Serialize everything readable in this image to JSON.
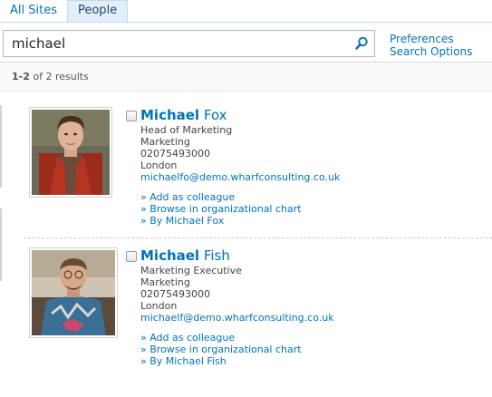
{
  "tabs": [
    {
      "label": "All Sites",
      "active": false
    },
    {
      "label": "People",
      "active": true
    }
  ],
  "search": {
    "query": "michael",
    "button_icon": "search-icon"
  },
  "links": {
    "preferences": "Preferences",
    "search_options": "Search Options"
  },
  "results_summary": {
    "range": "1-2",
    "text": "of 2 results"
  },
  "results": [
    {
      "name_highlight": "Michael",
      "name_rest": " Fox",
      "title": "Head of Marketing",
      "department": "Marketing",
      "phone": "02075493000",
      "location": "London",
      "email": "michaelfo@demo.wharfconsulting.co.uk",
      "actions": [
        "» Add as colleague",
        "» Browse in organizational chart",
        "» By Michael Fox"
      ]
    },
    {
      "name_highlight": "Michael",
      "name_rest": " Fish",
      "title": "Marketing Executive",
      "department": "Marketing",
      "phone": "02075493000",
      "location": "London",
      "email": "michaelf@demo.wharfconsulting.co.uk",
      "actions": [
        "» Add as colleague",
        "» Browse in organizational chart",
        "» By Michael Fish"
      ]
    }
  ],
  "colors": {
    "link": "#0072bc",
    "tab_active_bg": "#e3eff8"
  }
}
